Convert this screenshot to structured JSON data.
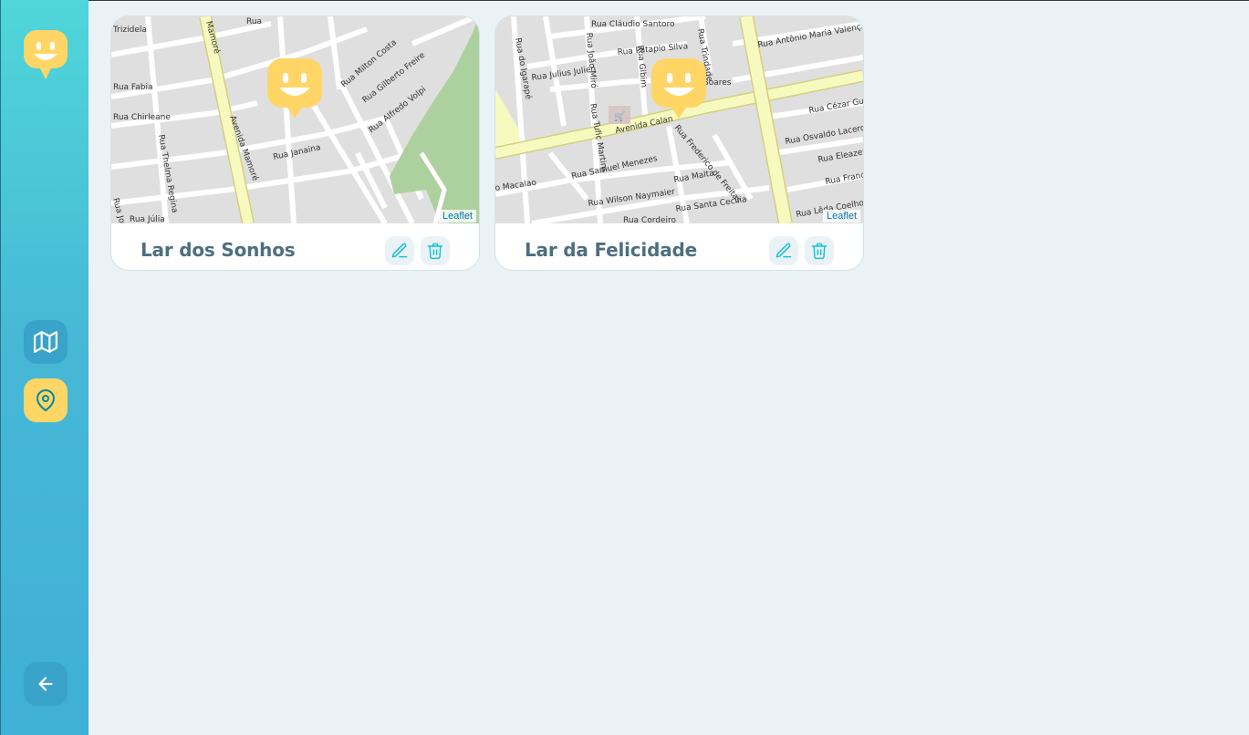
{
  "sidebar": {
    "logo_icon": "smiley-marker-icon",
    "nav": [
      {
        "name": "map-nav-button",
        "icon": "map-icon"
      },
      {
        "name": "orphanages-nav-button",
        "icon": "map-pin-icon",
        "active": true
      }
    ],
    "back_icon": "arrow-left-icon"
  },
  "colors": {
    "sidebar_top": "#4fd6d9",
    "sidebar_bottom": "#3fb0d6",
    "accent_yellow": "#ffd666",
    "title_text": "#4d6f80",
    "action_icon": "#15c3d6",
    "page_bg": "#ebf2f5"
  },
  "cards": [
    {
      "title": "Lar dos Sonhos",
      "map_attribution": "Leaflet",
      "streets": [
        "Trizidela",
        "Rua Fabia",
        "Rua Chirleane",
        "Rua Thelma Regina",
        "Rua José O",
        "Rua Júlia",
        "Avenida Mamoré",
        "Mamoré",
        "Rua Milton Costa",
        "Rua Gilberto Freire",
        "Rua Alfredo Volpi",
        "Rua Janaina"
      ],
      "edit_icon": "pencil-icon",
      "delete_icon": "trash-icon"
    },
    {
      "title": "Lar da Felicidade",
      "map_attribution": "Leaflet",
      "streets": [
        "Rua Cláudio Santoro",
        "Rua Patapio Silva",
        "Rua Julius Julien",
        "Rua do Igarapé",
        "Rua João Miró",
        "Rua Gibim",
        "Rua Trindade",
        "Rua Antônio Maria Valença",
        "Avenida Calan",
        "Rua Tufic Martins",
        "Rua Frederico de Freitas",
        "Rua Samuel Menezes",
        "Rua Macalao",
        "Rua Wilson Naymaier",
        "Rua Malta",
        "Rua Santa Cecília",
        "Rua Cézar Gue",
        "Rua Osvaldo Lacerda",
        "Rua Eleazer",
        "Rua Franc",
        "Rua Lêda Coelho",
        "Soares",
        "Rua Cordeiro"
      ],
      "edit_icon": "pencil-icon",
      "delete_icon": "trash-icon"
    }
  ]
}
